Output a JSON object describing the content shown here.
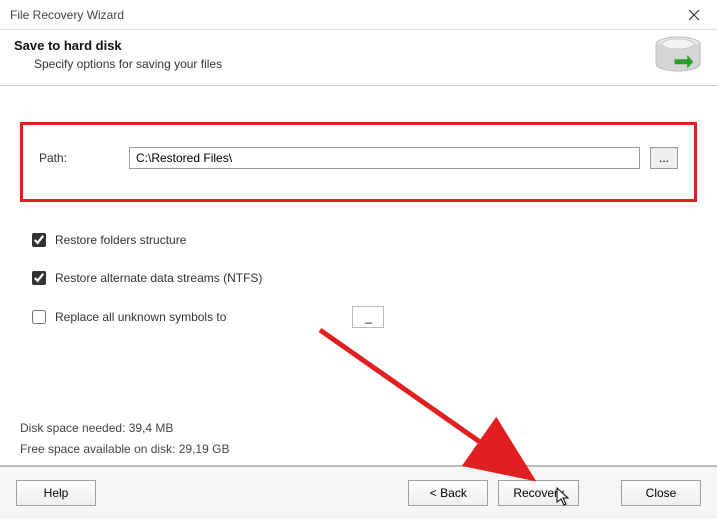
{
  "window": {
    "title": "File Recovery Wizard"
  },
  "header": {
    "heading": "Save to hard disk",
    "subtitle": "Specify options for saving your files"
  },
  "path": {
    "label": "Path:",
    "value": "C:\\Restored Files\\",
    "browse_label": "..."
  },
  "options": {
    "restore_folders": {
      "label": "Restore folders structure",
      "checked": true
    },
    "restore_ads": {
      "label": "Restore alternate data streams (NTFS)",
      "checked": true
    },
    "replace_symbols": {
      "label": "Replace all unknown symbols to",
      "checked": false,
      "value": "_"
    }
  },
  "stats": {
    "needed": "Disk space needed: 39,4 MB",
    "available": "Free space available on disk: 29,19 GB"
  },
  "buttons": {
    "help": "Help",
    "back": "< Back",
    "recovery": "Recovery",
    "close": "Close"
  }
}
